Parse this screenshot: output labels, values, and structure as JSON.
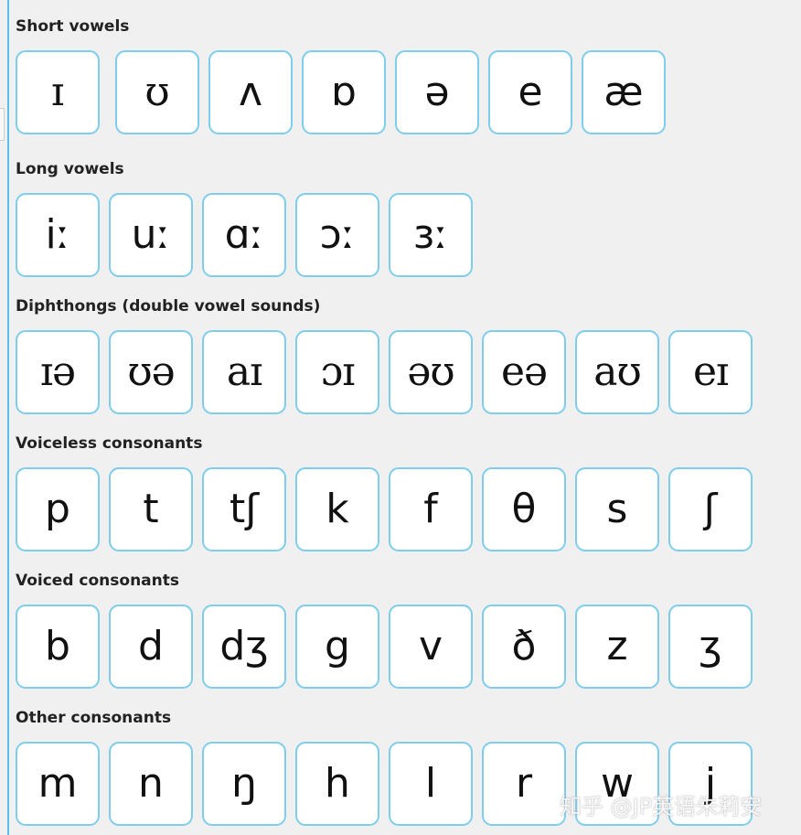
{
  "sections": [
    {
      "title": "Short vowels",
      "symbols": [
        "ɪ",
        "ʊ",
        "ʌ",
        "ɒ",
        "ə",
        "e",
        "æ"
      ]
    },
    {
      "title": "Long vowels",
      "symbols": [
        "iː",
        "uː",
        "ɑː",
        "ɔː",
        "ɜː"
      ]
    },
    {
      "title": "Diphthongs (double vowel sounds)",
      "symbols": [
        "ɪə",
        "ʊə",
        "aɪ",
        "ɔɪ",
        "əʊ",
        "eə",
        "aʊ",
        "eɪ"
      ]
    },
    {
      "title": "Voiceless consonants",
      "symbols": [
        "p",
        "t",
        "tʃ",
        "k",
        "f",
        "θ",
        "s",
        "ʃ"
      ]
    },
    {
      "title": "Voiced consonants",
      "symbols": [
        "b",
        "d",
        "dʒ",
        "g",
        "v",
        "ð",
        "z",
        "ʒ"
      ]
    },
    {
      "title": "Other consonants",
      "symbols": [
        "m",
        "n",
        "ŋ",
        "h",
        "l",
        "r",
        "w",
        "j"
      ]
    }
  ],
  "watermark": "知乎 @JP英语朱莉安",
  "colors": {
    "background": "#f0f0f0",
    "tile_border": "#7fcdec",
    "left_rule": "#5cbde6",
    "tile_fill": "#ffffff",
    "text": "#111111"
  }
}
